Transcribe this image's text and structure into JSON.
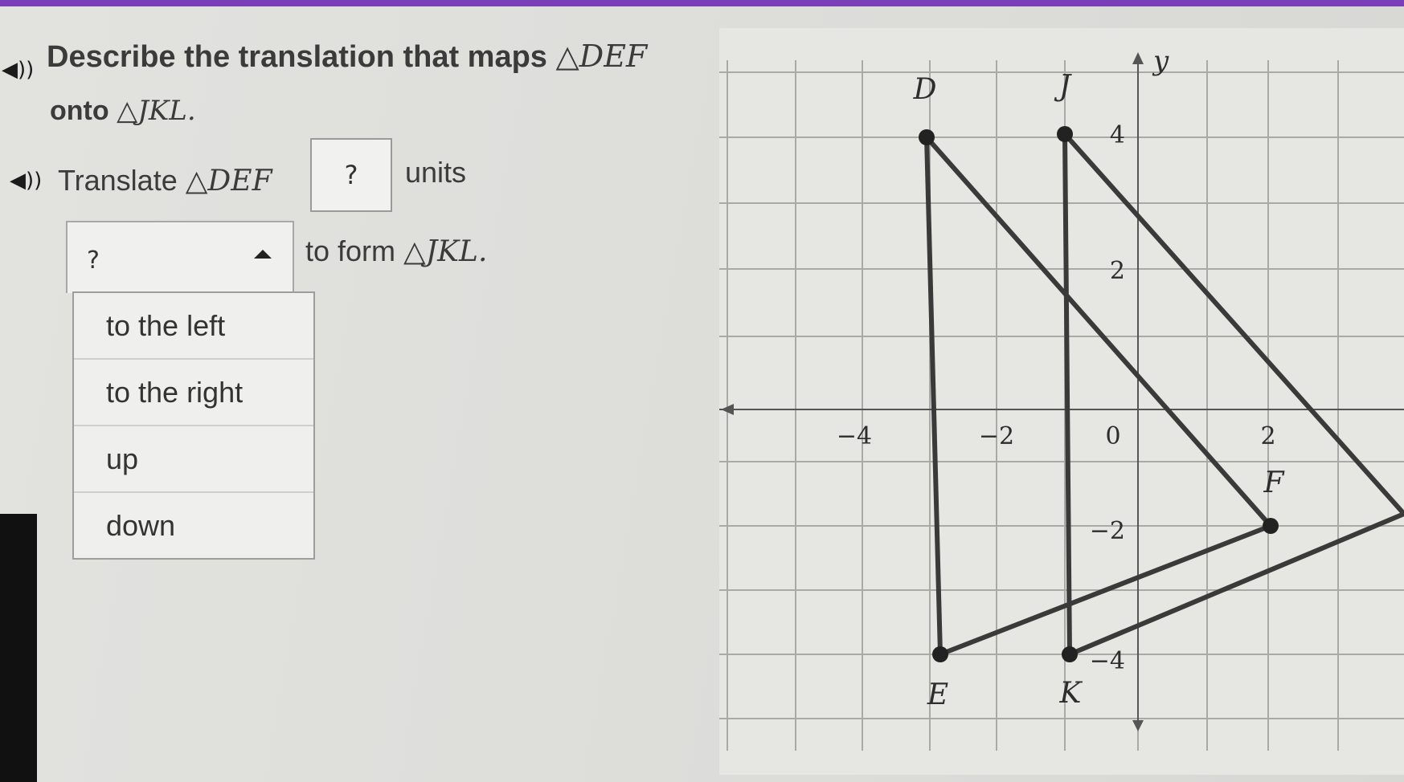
{
  "question": {
    "line1": "Describe the translation that maps",
    "triangle1": "△DEF",
    "line2": "onto",
    "triangle2": "△JKL."
  },
  "prompt": {
    "translate_word": "Translate",
    "triangle": "△DEF",
    "answer_placeholder": "?",
    "units_word": "units",
    "to_form": "to form",
    "target_triangle": "△JKL."
  },
  "dropdown": {
    "selected": "?",
    "options": [
      "to the left",
      "to the right",
      "up",
      "down"
    ]
  },
  "graph": {
    "axis_y_label": "y",
    "x_ticks": [
      "−4",
      "−2",
      "0",
      "2"
    ],
    "y_ticks": [
      "4",
      "2",
      "−2",
      "−4"
    ],
    "points": {
      "D": {
        "label": "D",
        "x": -3,
        "y": 4
      },
      "E": {
        "label": "E",
        "x": -3,
        "y": -4
      },
      "F": {
        "label": "F",
        "x": 2,
        "y": -2
      },
      "J": {
        "label": "J",
        "x": -1,
        "y": 4
      },
      "K": {
        "label": "K",
        "x": -1,
        "y": -4
      }
    }
  },
  "colors": {
    "accent": "#7a3fb8",
    "line": "#3a3a3a"
  }
}
